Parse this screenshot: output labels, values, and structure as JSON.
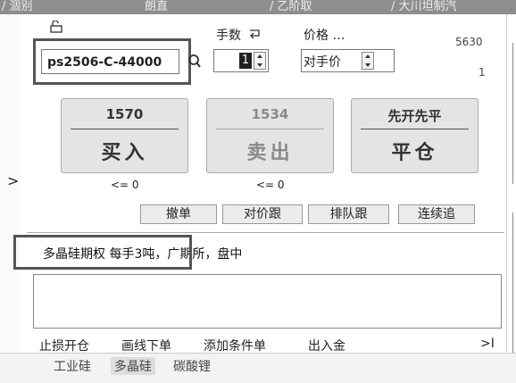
{
  "topbar": {
    "fragments": [
      "/ 涸别",
      "朗直",
      "/ 乙阶取",
      "/ 大川坦制汽"
    ]
  },
  "contract": {
    "code": "ps2506-C-44000"
  },
  "order": {
    "qty_label": "手数",
    "qty_value": "1",
    "price_label": "价格 …",
    "price_value": "对手价",
    "side_num_top": "5630",
    "side_num_bottom": "1"
  },
  "trade_buttons": {
    "buy": {
      "price": "1570",
      "label": "买入",
      "limit": "<= 0"
    },
    "sell": {
      "price": "1534",
      "label": "卖出",
      "limit": "<= 0"
    },
    "close": {
      "price": "先开先平",
      "label": "平仓"
    }
  },
  "actions": {
    "cancel": "撤单",
    "follow": "对价跟",
    "queue": "排队跟",
    "chase": "连续追"
  },
  "info": {
    "text": "多晶硅期权 每手3吨，广期所，盘中"
  },
  "links": {
    "stop_open": "止损开仓",
    "line_order": "画线下单",
    "add_condition": "添加条件单",
    "funds": "出入金",
    "more": ">I"
  },
  "bottom_tabs": [
    "工业硅",
    "多晶硅",
    "碳酸锂"
  ],
  "nav": {
    "left_arrow": ">"
  }
}
